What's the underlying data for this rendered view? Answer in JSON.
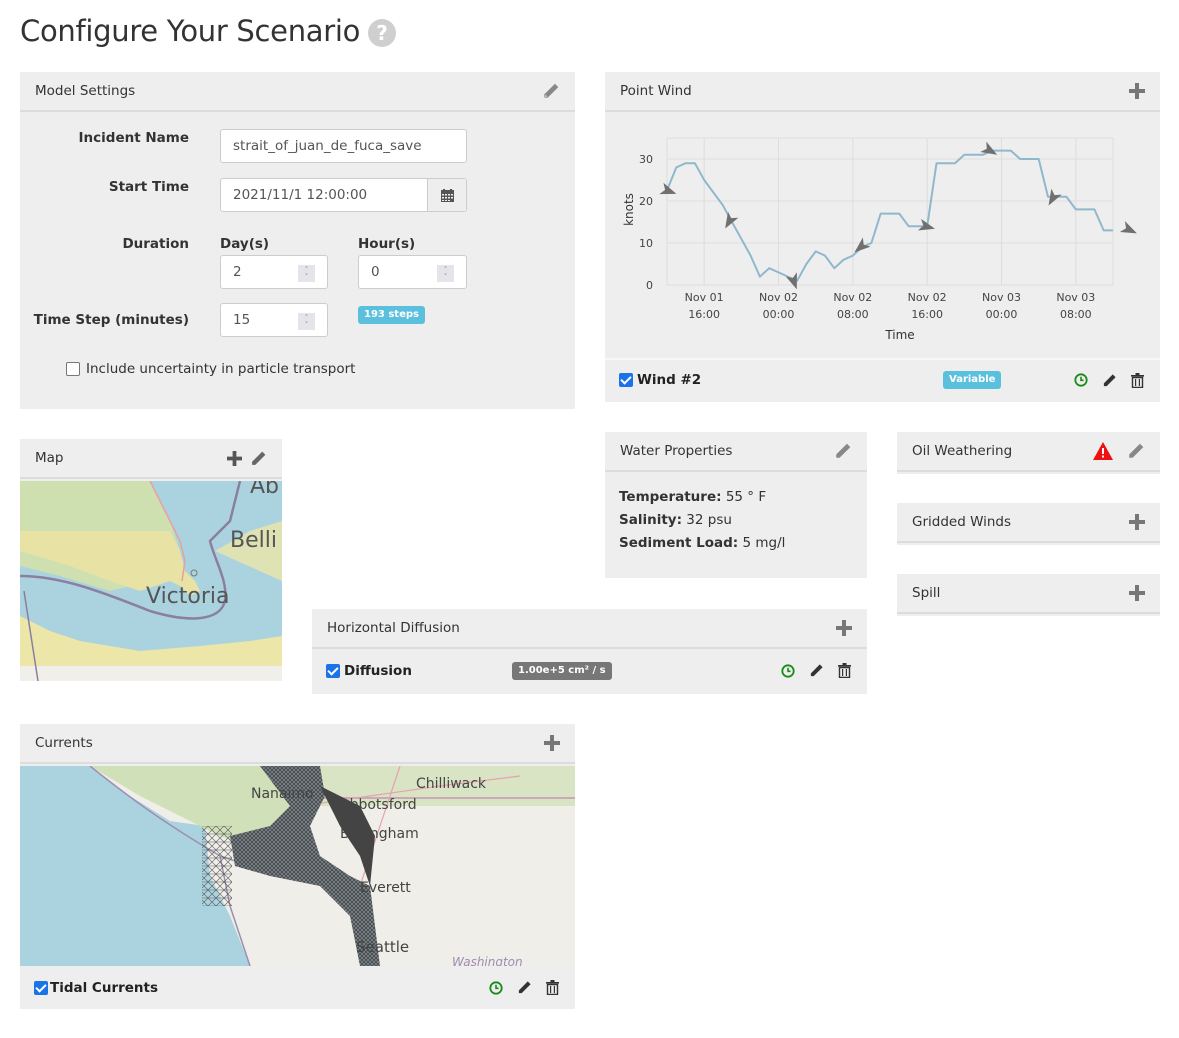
{
  "page": {
    "title": "Configure Your Scenario",
    "help_icon": "question-circle-icon"
  },
  "model_settings": {
    "title": "Model Settings",
    "incident_name_label": "Incident Name",
    "incident_name_value": "strait_of_juan_de_fuca_save",
    "start_time_label": "Start Time",
    "start_time_value": "2021/11/1 12:00:00",
    "duration_label": "Duration",
    "days_label": "Day(s)",
    "days_value": "2",
    "hours_label": "Hour(s)",
    "hours_value": "0",
    "time_step_label": "Time Step (minutes)",
    "time_step_value": "15",
    "steps_badge": "193 steps",
    "uncertainty_label": "Include uncertainty in particle transport",
    "uncertainty_checked": false
  },
  "point_wind": {
    "title": "Point Wind",
    "item_name": "Wind #2",
    "item_checked": true,
    "item_badge": "Variable"
  },
  "map_panel": {
    "title": "Map",
    "labels": [
      "Victoria",
      "Belli",
      "Ab"
    ]
  },
  "water_properties": {
    "title": "Water Properties",
    "temperature_label": "Temperature:",
    "temperature_value": "55 ° F",
    "salinity_label": "Salinity:",
    "salinity_value": "32 psu",
    "sediment_label": "Sediment Load:",
    "sediment_value": "5 mg/l"
  },
  "oil_weathering": {
    "title": "Oil Weathering",
    "warning": true
  },
  "gridded_winds": {
    "title": "Gridded Winds"
  },
  "spill": {
    "title": "Spill"
  },
  "horizontal_diffusion": {
    "title": "Horizontal Diffusion",
    "item_name": "Diffusion",
    "item_checked": true,
    "item_badge": "1.00e+5 cm² / s"
  },
  "currents": {
    "title": "Currents",
    "item_name": "Tidal Currents",
    "item_checked": true,
    "map_labels": [
      "Nanaimo",
      "Chilliwack",
      "Abbotsford",
      "Bellingham",
      "Everett",
      "Seattle",
      "Washington"
    ]
  },
  "colors": {
    "panel_bg": "#eeeeee",
    "line": "#8fb8cc",
    "badge_info": "#5bc0de",
    "badge_gray": "#777777",
    "clock_green": "#1a8a1a",
    "warning_red": "#ee1111",
    "checkbox_blue": "#1a73e8"
  },
  "chart_data": {
    "type": "line",
    "title": "",
    "xlabel": "Time",
    "ylabel": "knots",
    "x_start": "2021-11-01 12:00",
    "x_unit": "hours",
    "xlim": [
      0,
      48
    ],
    "ylim": [
      0,
      35
    ],
    "yticks": [
      0,
      10,
      20,
      30
    ],
    "xticks": [
      {
        "hour": 4,
        "line1": "Nov 01",
        "line2": "16:00"
      },
      {
        "hour": 12,
        "line1": "Nov 02",
        "line2": "00:00"
      },
      {
        "hour": 20,
        "line1": "Nov 02",
        "line2": "08:00"
      },
      {
        "hour": 28,
        "line1": "Nov 02",
        "line2": "16:00"
      },
      {
        "hour": 36,
        "line1": "Nov 03",
        "line2": "00:00"
      },
      {
        "hour": 44,
        "line1": "Nov 03",
        "line2": "08:00"
      }
    ],
    "grid": true,
    "series": [
      {
        "name": "Wind #2 speed",
        "x": [
          0,
          1,
          2,
          3,
          4,
          5,
          6,
          7,
          8,
          9,
          10,
          11,
          12,
          13,
          14,
          15,
          16,
          17,
          18,
          19,
          20,
          21,
          22,
          23,
          24,
          25,
          26,
          27,
          28,
          29,
          30,
          31,
          32,
          33,
          34,
          35,
          36,
          37,
          38,
          39,
          40,
          41,
          42,
          43,
          44,
          45,
          46,
          47,
          48
        ],
        "values": [
          22.5,
          28,
          29,
          29,
          25,
          22,
          19,
          15,
          11,
          7,
          2,
          4,
          3,
          2,
          1,
          5,
          8,
          7,
          4,
          6,
          7,
          9,
          10,
          17,
          17,
          17,
          14,
          14,
          14,
          29,
          29,
          29,
          31,
          31,
          31,
          32,
          32,
          32,
          30,
          30,
          30,
          21,
          21,
          21,
          18,
          18,
          18,
          13,
          13
        ]
      }
    ],
    "direction_arrows": [
      {
        "hour": 0,
        "speed": 22.5,
        "angle": 200
      },
      {
        "hour": 6.8,
        "speed": 15.5,
        "angle": 300
      },
      {
        "hour": 13.6,
        "speed": 1.2,
        "angle": 250
      },
      {
        "hour": 21,
        "speed": 9.3,
        "angle": 320
      },
      {
        "hour": 27.8,
        "speed": 14,
        "angle": 195
      },
      {
        "hour": 34.6,
        "speed": 32.2,
        "angle": 210
      },
      {
        "hour": 41.6,
        "speed": 21,
        "angle": 300
      },
      {
        "hour": 49.6,
        "speed": 13.3,
        "angle": 205
      }
    ]
  }
}
